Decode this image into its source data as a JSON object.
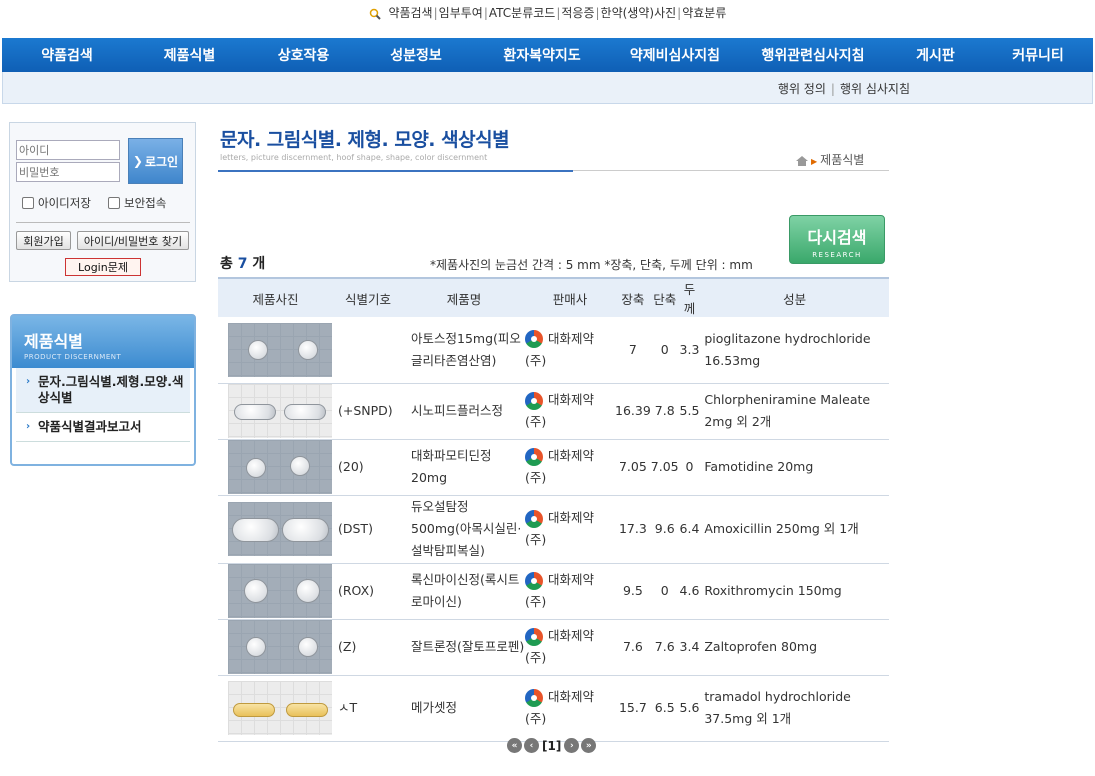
{
  "top_links": [
    "약품검색",
    "임부투여",
    "ATC분류코드",
    "적응증",
    "한약(생약)사진",
    "약효분류"
  ],
  "main_nav": [
    "약품검색",
    "제품식별",
    "상호작용",
    "성분정보",
    "환자복약지도",
    "약제비심사지침",
    "행위관련심사지침",
    "게시판",
    "커뮤니티"
  ],
  "sub_nav": [
    "행위 정의",
    "행위 심사지침"
  ],
  "login": {
    "id_placeholder": "아이디",
    "pw_placeholder": "비밀번호",
    "login_button": "로그인",
    "save_id": "아이디저장",
    "secure": "보안접속",
    "join": "회원가입",
    "find": "아이디/비밀번호 찾기",
    "problem": "Login문제"
  },
  "sidemenu": {
    "title": "제품식별",
    "subtitle": "PRODUCT DISCERNMENT",
    "items": [
      "문자.그림식별.제형.모양.색상식별",
      "약품식별결과보고서"
    ]
  },
  "page": {
    "title": "문자. 그림식별. 제형. 모양. 색상식별",
    "subtitle": "letters, picture discernment, hoof shape, shape, color discernment",
    "breadcrumb": "제품식별",
    "research_label": "다시검색",
    "research_sub": "RESEARCH",
    "count_prefix": "총",
    "count": "7",
    "count_suffix": "개",
    "note": "*제품사진의 눈금선 간격 : 5 mm *장축, 단축, 두께 단위 : mm"
  },
  "table": {
    "headers": [
      "제품사진",
      "식별기호",
      "제품명",
      "판매사",
      "장축",
      "단축",
      "두께",
      "성분"
    ],
    "rows": [
      {
        "code": "",
        "name": "아토스정15mg(피오글리타존염산염)",
        "seller": "대화제약(주)",
        "long": "7",
        "short": "0",
        "thick": "3.3",
        "ingredient": "pioglitazone hydrochloride 16.53mg"
      },
      {
        "code": "(+SNPD)",
        "name": "시노피드플러스정",
        "seller": "대화제약(주)",
        "long": "16.39",
        "short": "7.8",
        "thick": "5.5",
        "ingredient": "Chlorpheniramine Maleate 2mg 외 2개"
      },
      {
        "code": "(20)",
        "name": "대화파모티딘정20mg",
        "seller": "대화제약(주)",
        "long": "7.05",
        "short": "7.05",
        "thick": "0",
        "ingredient": "Famotidine 20mg"
      },
      {
        "code": "(DST)",
        "name": "듀오설탐정500mg(아목시실린·설박탐피복실)",
        "seller": "대화제약(주)",
        "long": "17.3",
        "short": "9.6",
        "thick": "6.4",
        "ingredient": "Amoxicillin 250mg 외 1개"
      },
      {
        "code": "(ROX)",
        "name": "록신마이신정(록시트로마이신)",
        "seller": "대화제약(주)",
        "long": "9.5",
        "short": "0",
        "thick": "4.6",
        "ingredient": "Roxithromycin 150mg"
      },
      {
        "code": "(Z)",
        "name": "잘트론정(잘토프로펜)",
        "seller": "대화제약(주)",
        "long": "7.6",
        "short": "7.6",
        "thick": "3.4",
        "ingredient": "Zaltoprofen 80mg"
      },
      {
        "code": "ㅅT",
        "name": "메가셋정",
        "seller": "대화제약(주)",
        "long": "15.7",
        "short": "6.5",
        "thick": "5.6",
        "ingredient": "tramadol hydrochloride 37.5mg 외 1개"
      }
    ]
  },
  "pager": {
    "current": "[1]"
  }
}
